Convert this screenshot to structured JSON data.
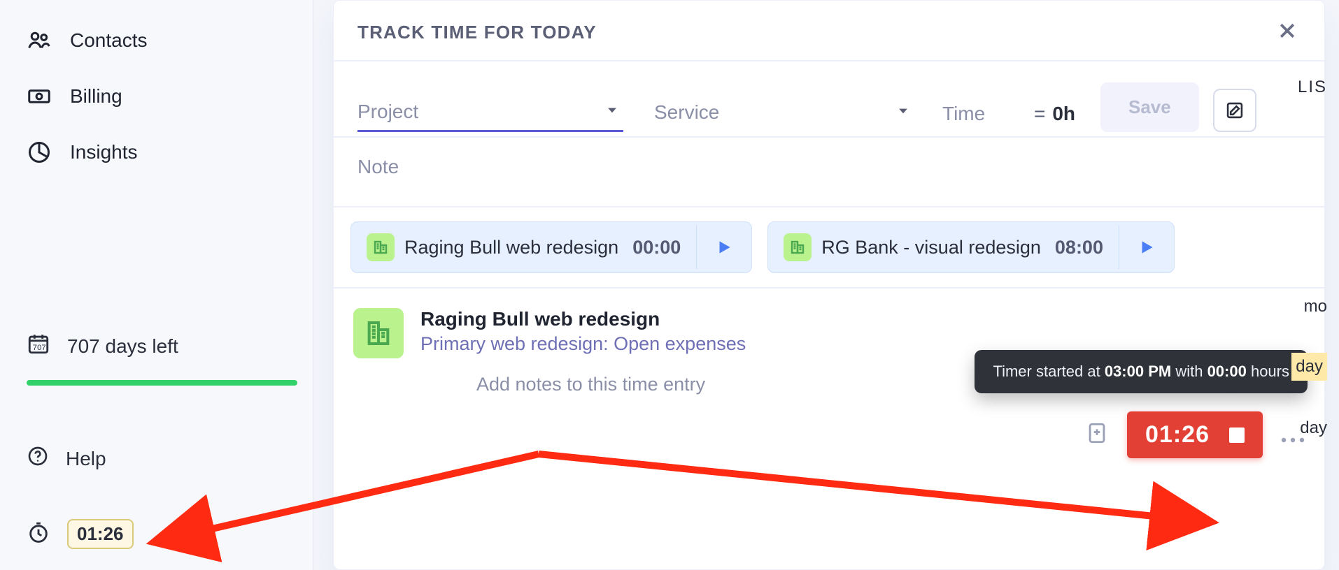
{
  "sidebar": {
    "items": [
      {
        "label": "Contacts"
      },
      {
        "label": "Billing"
      },
      {
        "label": "Insights"
      }
    ],
    "trial": {
      "label": "707 days left"
    },
    "help": {
      "label": "Help"
    },
    "timer": {
      "value": "01:26"
    }
  },
  "panel": {
    "title": "TRACK TIME FOR TODAY",
    "fields": {
      "project_label": "Project",
      "service_label": "Service",
      "time_label": "Time",
      "time_eq": "=",
      "time_value": "0h",
      "save_label": "Save",
      "note_label": "Note"
    },
    "chips": [
      {
        "name": "Raging Bull web redesign",
        "time": "00:00"
      },
      {
        "name": "RG Bank - visual redesign",
        "time": "08:00"
      }
    ],
    "entry": {
      "title": "Raging Bull web redesign",
      "subtitle": "Primary web redesign: Open expenses",
      "note_placeholder": "Add notes to this time entry",
      "running_time": "01:26"
    },
    "tooltip": {
      "prefix": "Timer started at ",
      "time": "03:00 PM",
      "middle": " with ",
      "hours": "00:00",
      "suffix": " hours"
    }
  },
  "edge": {
    "list": "LIS",
    "mo": "mo",
    "day1": "day",
    "day2": "day"
  }
}
